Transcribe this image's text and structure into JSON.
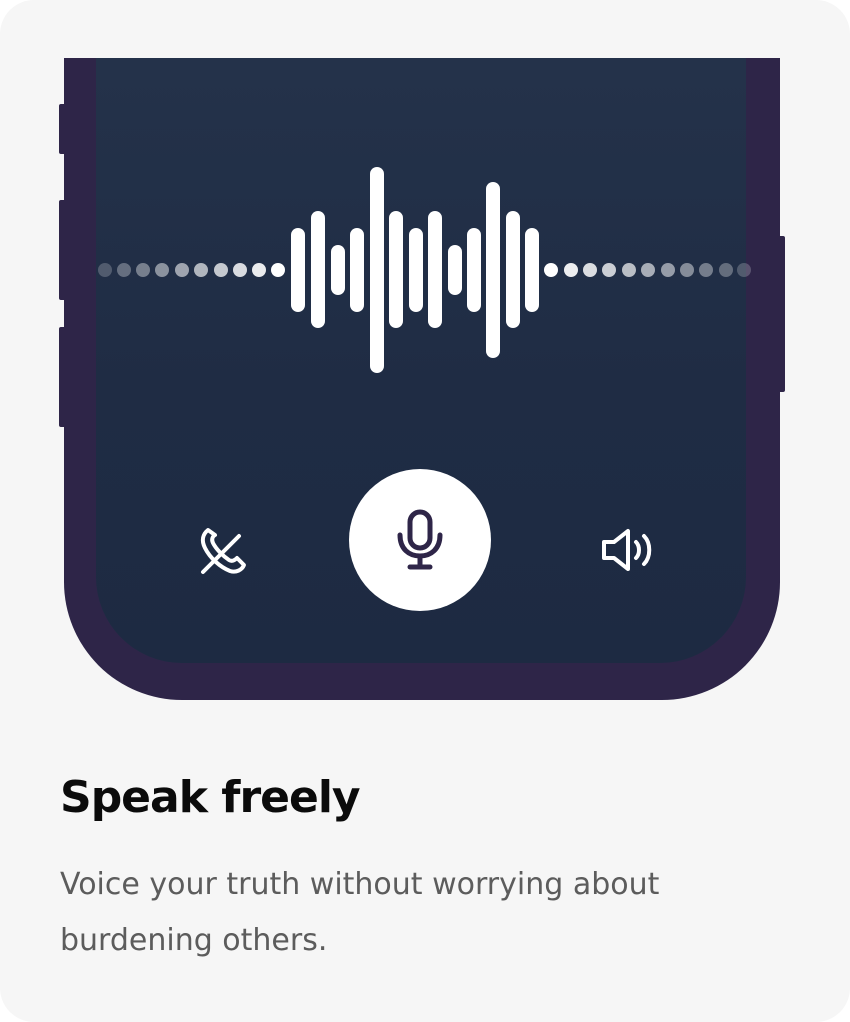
{
  "card": {
    "title": "Speak freely",
    "description": "Voice your truth without worrying about burdening others."
  },
  "call_controls": {
    "hangup_icon": "phone-hangup-icon",
    "mic_icon": "microphone-icon",
    "speaker_icon": "speaker-icon"
  },
  "colors": {
    "card_background": "#f6f6f6",
    "phone_frame": "#2e2548",
    "screen_background": "#1f2c44",
    "waveform": "#ffffff",
    "mic_button": "#ffffff",
    "mic_icon": "#2e2548",
    "title": "#0b0b0b",
    "description": "#5c5c5c"
  }
}
